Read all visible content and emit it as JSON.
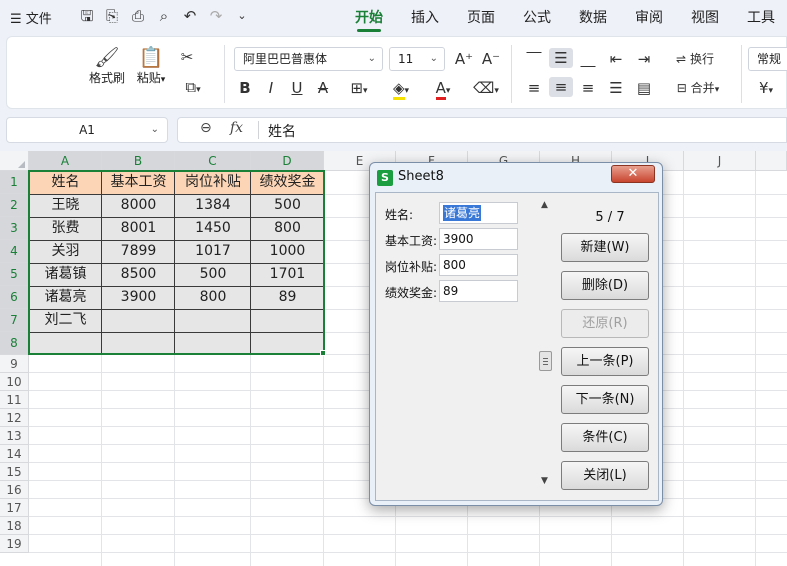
{
  "menubar": {
    "file_label": "文件",
    "tabs": [
      "开始",
      "插入",
      "页面",
      "公式",
      "数据",
      "审阅",
      "视图",
      "工具"
    ],
    "active_tab": "开始"
  },
  "ribbon": {
    "format_painter": "格式刷",
    "paste": "粘贴",
    "font_name": "阿里巴巴普惠体",
    "font_size": "11",
    "wrap_text": "换行",
    "merge": "合并",
    "number_format": "常规",
    "currency_symbol": "¥",
    "bold": "B",
    "italic": "I",
    "underline": "U",
    "strike": "A",
    "font_color_letter": "A",
    "highlight_color": "#f5e000",
    "font_color": "#e02020",
    "font_size_up": "A⁺",
    "font_size_down": "A⁻"
  },
  "formula_bar": {
    "cell_ref": "A1",
    "fx_label": "fx",
    "value": "姓名"
  },
  "sheet": {
    "columns": [
      "A",
      "B",
      "C",
      "D",
      "E",
      "F",
      "G",
      "H",
      "I",
      "J"
    ],
    "rows": [
      "1",
      "2",
      "3",
      "4",
      "5",
      "6",
      "7",
      "8",
      "9",
      "10",
      "11",
      "12",
      "13",
      "14",
      "15",
      "16",
      "17",
      "18",
      "19"
    ],
    "headers": [
      "姓名",
      "基本工资",
      "岗位补贴",
      "绩效奖金"
    ],
    "data": [
      [
        "王晓",
        "8000",
        "1384",
        "500"
      ],
      [
        "张费",
        "8001",
        "1450",
        "800"
      ],
      [
        "关羽",
        "7899",
        "1017",
        "1000"
      ],
      [
        "诸葛镇",
        "8500",
        "500",
        "1701"
      ],
      [
        "诸葛亮",
        "3900",
        "800",
        "89"
      ],
      [
        "刘二飞",
        "",
        "",
        ""
      ]
    ],
    "header_fill": "#fbd5b5",
    "selection_color": "#1a7f37"
  },
  "dialog": {
    "title": "Sheet8",
    "icon_letter": "S",
    "close_glyph": "✕",
    "fields": [
      {
        "label": "姓名:",
        "value": "诸葛亮"
      },
      {
        "label": "基本工资:",
        "value": "3900"
      },
      {
        "label": "岗位补贴:",
        "value": "800"
      },
      {
        "label": "绩效奖金:",
        "value": "89"
      }
    ],
    "record_counter": "5 / 7",
    "buttons": [
      {
        "label": "新建(W)",
        "enabled": true
      },
      {
        "label": "删除(D)",
        "enabled": true
      },
      {
        "label": "还原(R)",
        "enabled": false
      },
      {
        "label": "上一条(P)",
        "enabled": true
      },
      {
        "label": "下一条(N)",
        "enabled": true
      },
      {
        "label": "条件(C)",
        "enabled": true
      },
      {
        "label": "关闭(L)",
        "enabled": true
      }
    ]
  }
}
